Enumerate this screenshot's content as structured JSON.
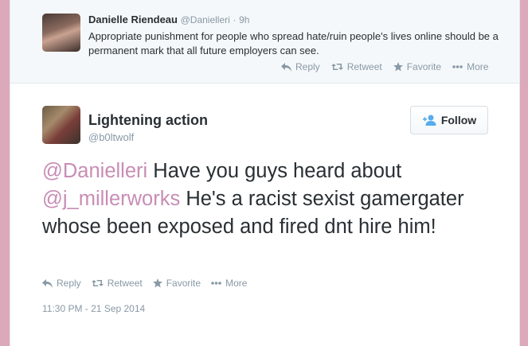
{
  "context_tweet": {
    "name": "Danielle Riendeau",
    "handle": "@Danielleri",
    "separator": "·",
    "time": "9h",
    "text": "Appropriate punishment for people who spread hate/ruin people's lives online should be a permanent mark that all future employers can see.",
    "actions": {
      "reply": "Reply",
      "retweet": "Retweet",
      "favorite": "Favorite",
      "more": "More"
    }
  },
  "main_tweet": {
    "name": "Lightening action",
    "handle": "@b0ltwolf",
    "follow_label": "Follow",
    "mention1": "@Danielleri",
    "text1": " Have you guys heard about ",
    "mention2": "@j_millerworks",
    "text2": " He's a racist sexist gamergater whose been exposed and fired dnt hire him!",
    "actions": {
      "reply": "Reply",
      "retweet": "Retweet",
      "favorite": "Favorite",
      "more": "More"
    },
    "timestamp": "11:30 PM - 21 Sep 2014"
  },
  "colors": {
    "page_background": "#dba9b9",
    "mention": "#c88db5",
    "muted": "#8899a6",
    "follow_icon": "#55acee"
  },
  "icons": [
    "reply-icon",
    "retweet-icon",
    "favorite-icon",
    "more-icon",
    "follow-user-icon"
  ]
}
